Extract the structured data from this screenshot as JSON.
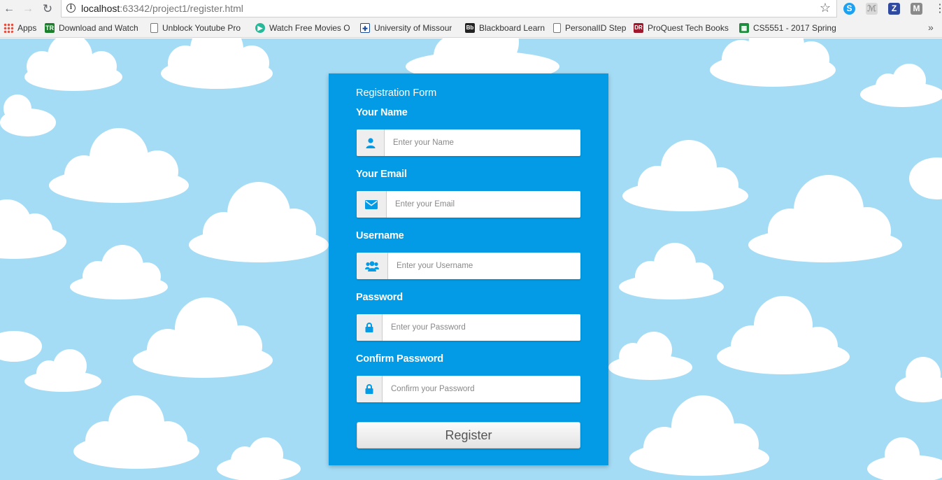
{
  "browser": {
    "url_host": "localhost",
    "url_rest": ":63342/project1/register.html",
    "bookmarks": [
      {
        "label": "Apps",
        "icon": "apps-grid-icon"
      },
      {
        "label": "Download and Watch",
        "icon": "tr-favicon-icon",
        "color": "#1b7f2c"
      },
      {
        "label": "Unblock Youtube Pro",
        "icon": "page-icon"
      },
      {
        "label": "Watch Free Movies O",
        "icon": "play-circle-icon",
        "color": "#26b99a"
      },
      {
        "label": "University of Missour",
        "icon": "mizzou-icon",
        "color": "#1a4c9b"
      },
      {
        "label": "Blackboard Learn",
        "icon": "blackboard-icon",
        "color": "#222222"
      },
      {
        "label": "PersonalID Step",
        "icon": "page-icon"
      },
      {
        "label": "ProQuest Tech Books",
        "icon": "proquest-icon",
        "color": "#a0182c"
      },
      {
        "label": "CS5551 - 2017 Spring",
        "icon": "sheets-icon",
        "color": "#1e8e3e"
      }
    ]
  },
  "form": {
    "title": "Registration Form",
    "name": {
      "label": "Your Name",
      "placeholder": "Enter your Name",
      "icon": "user-icon"
    },
    "email": {
      "label": "Your Email",
      "placeholder": "Enter your Email",
      "icon": "envelope-icon"
    },
    "username": {
      "label": "Username",
      "placeholder": "Enter your Username",
      "icon": "users-icon"
    },
    "password": {
      "label": "Password",
      "placeholder": "Enter your Password",
      "icon": "lock-icon"
    },
    "confirm": {
      "label": "Confirm Password",
      "placeholder": "Confirm your Password",
      "icon": "lock-icon"
    },
    "register_label": "Register"
  },
  "colors": {
    "sky": "#a5dcf5",
    "card": "#039be5",
    "icon": "#039be5"
  }
}
